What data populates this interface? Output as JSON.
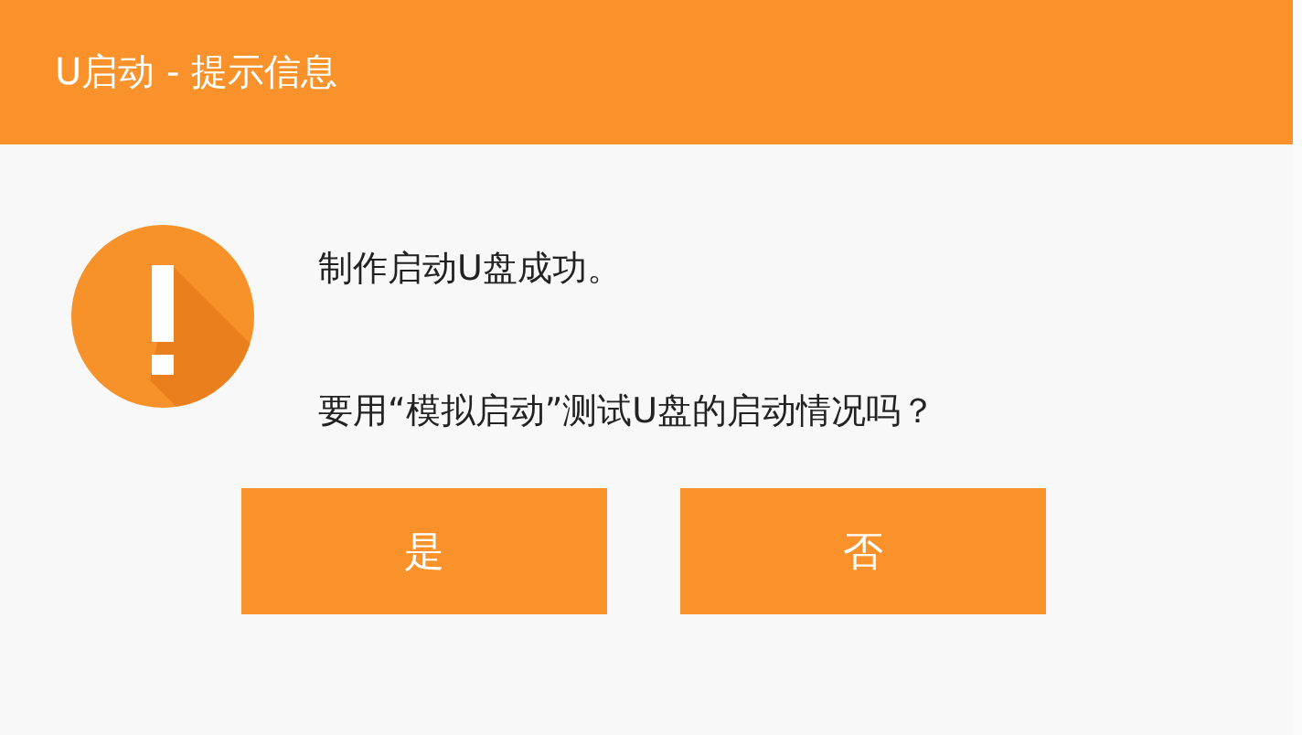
{
  "window": {
    "title": "U启动 - 提示信息"
  },
  "message": {
    "lines": [
      "制作启动U盘成功。",
      "要用“模拟启动”测试U盘的启动情况吗？"
    ]
  },
  "buttons": [
    {
      "label": "是"
    },
    {
      "label": "否"
    }
  ]
}
